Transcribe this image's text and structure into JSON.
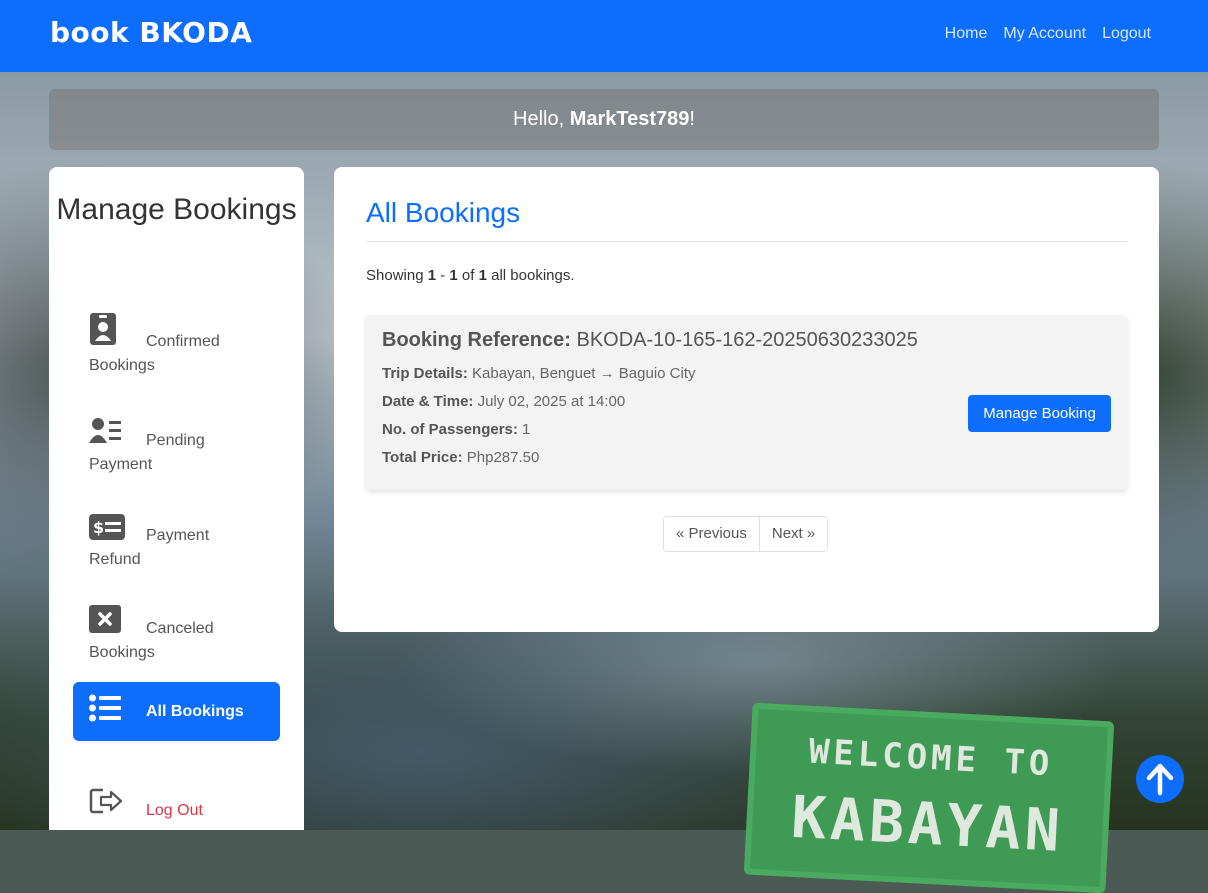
{
  "navbar": {
    "brand": "book BKODA",
    "links": [
      "Home",
      "My Account",
      "Logout"
    ]
  },
  "greeting": {
    "prefix": "Hello, ",
    "username": "MarkTest789",
    "suffix": "!"
  },
  "sidebar": {
    "title": "Manage Bookings",
    "items": [
      {
        "line1": "Confirmed",
        "line2": "Bookings",
        "icon": "id-badge-icon"
      },
      {
        "line1": "Pending",
        "line2": "Payment",
        "icon": "user-list-icon"
      },
      {
        "line1": "Payment",
        "line2": "Refund",
        "icon": "money-bill-icon"
      },
      {
        "line1": "Canceled",
        "line2": "Bookings",
        "icon": "cancel-box-icon"
      },
      {
        "line1": "All Bookings",
        "line2": "",
        "icon": "list-icon",
        "active": true
      },
      {
        "line1": "Log Out",
        "line2": "",
        "icon": "sign-out-icon"
      }
    ]
  },
  "main": {
    "title": "All Bookings",
    "showing": {
      "prefix": "Showing ",
      "from": "1",
      "dash": " - ",
      "to": "1",
      "of": " of ",
      "total": "1",
      "suffix": " all bookings."
    },
    "booking": {
      "ref_label": "Booking Reference:",
      "ref_value": "BKODA-10-165-162-20250630233025",
      "trip_label": "Trip Details:",
      "trip_value": "Kabayan, Benguet → Baguio City",
      "date_label": "Date & Time:",
      "date_value": "July 02, 2025 at 14:00",
      "pax_label": "No. of Passengers:",
      "pax_value": "1",
      "price_label": "Total Price:",
      "price_value": "Php287.50",
      "manage_button": "Manage Booking"
    },
    "pagination": {
      "previous": "« Previous",
      "next": "Next »"
    }
  },
  "background_sign": {
    "line1": "WELCOME TO",
    "line2": "KABAYAN"
  },
  "colors": {
    "primary": "#0d6efd",
    "logout": "#dc3545"
  }
}
